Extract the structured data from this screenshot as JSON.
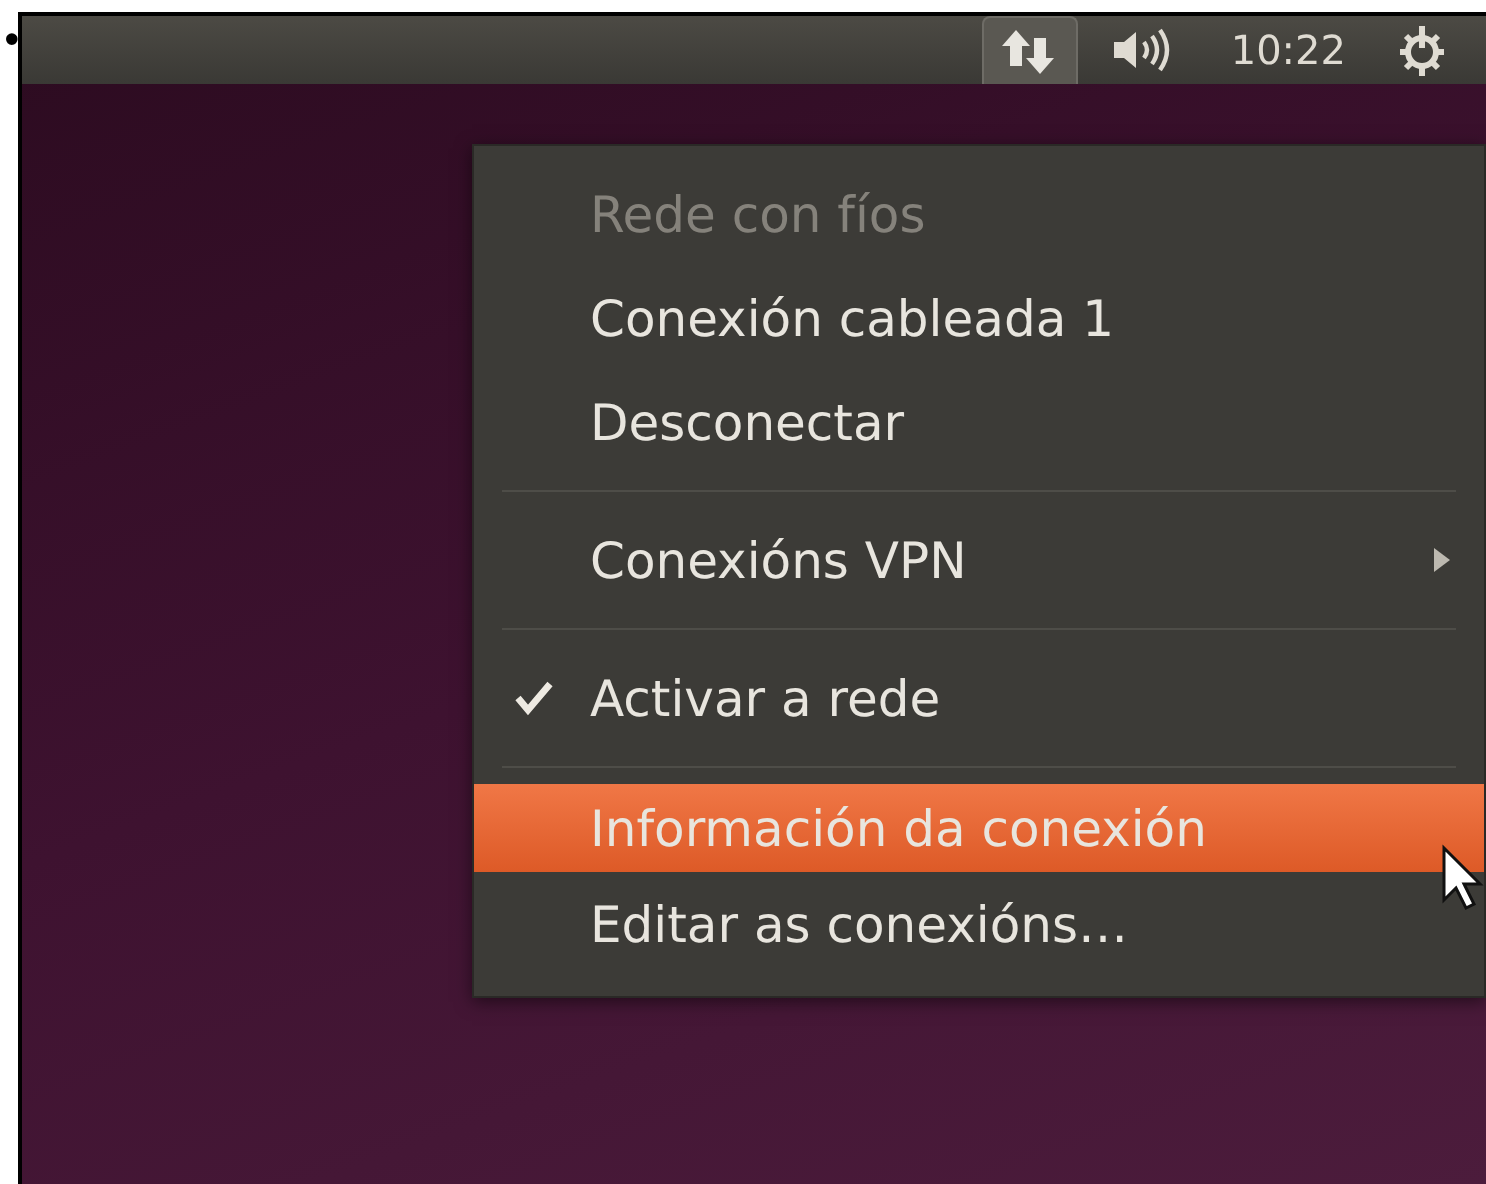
{
  "bullet": "•",
  "top_panel": {
    "indicators": [
      {
        "kind": "network",
        "selected": true
      },
      {
        "kind": "sound",
        "selected": false
      },
      {
        "kind": "clock",
        "label": "10:22",
        "selected": false
      },
      {
        "kind": "power",
        "selected": false
      }
    ]
  },
  "menu": {
    "items": [
      {
        "kind": "item",
        "label": "Rede con fíos",
        "disabled": true,
        "checked": false,
        "submenu": false,
        "selected": false
      },
      {
        "kind": "item",
        "label": "Conexión cableada 1",
        "disabled": false,
        "checked": false,
        "submenu": false,
        "selected": false
      },
      {
        "kind": "item",
        "label": "Desconectar",
        "disabled": false,
        "checked": false,
        "submenu": false,
        "selected": false
      },
      {
        "kind": "separator"
      },
      {
        "kind": "item",
        "label": "Conexións VPN",
        "disabled": false,
        "checked": false,
        "submenu": true,
        "selected": false
      },
      {
        "kind": "separator"
      },
      {
        "kind": "item",
        "label": "Activar a rede",
        "disabled": false,
        "checked": true,
        "submenu": false,
        "selected": false
      },
      {
        "kind": "separator"
      },
      {
        "kind": "item",
        "label": "Información da conexión",
        "disabled": false,
        "checked": false,
        "submenu": false,
        "selected": true
      },
      {
        "kind": "item",
        "label": "Editar as conexións…",
        "disabled": false,
        "checked": false,
        "submenu": false,
        "selected": false
      }
    ]
  }
}
